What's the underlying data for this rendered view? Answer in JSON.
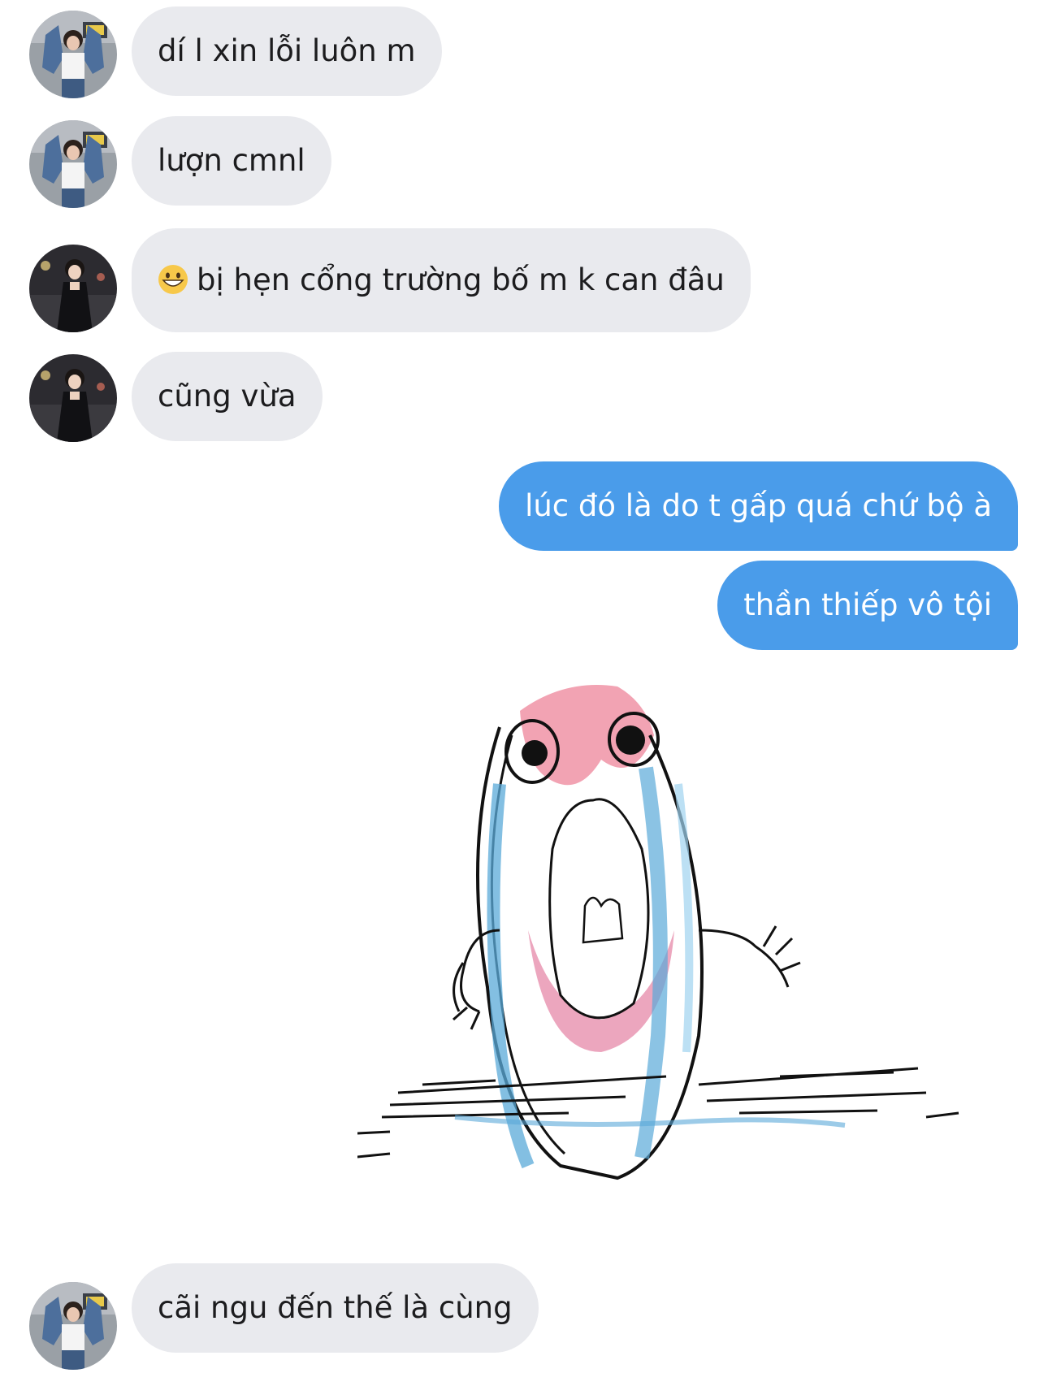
{
  "messages": [
    {
      "side": "in",
      "avatar": "user-denim-jacket",
      "text": "dí l xin lỗi luôn m"
    },
    {
      "side": "in",
      "avatar": "user-denim-jacket",
      "text": "lượn cmnl"
    },
    {
      "side": "in",
      "avatar": "user-black-dress",
      "emoji": "grinning-face-emoji",
      "text": "bị hẹn cổng trường bố m k can đâu"
    },
    {
      "side": "in",
      "avatar": "user-black-dress",
      "text": "cũng vừa"
    },
    {
      "side": "out",
      "text": "lúc đó là do t gấp quá chứ bộ à"
    },
    {
      "side": "out",
      "text": "thần thiếp vô tội"
    },
    {
      "side": "out",
      "sticker": "crying-blob-sticker"
    },
    {
      "side": "in",
      "avatar": "user-denim-jacket",
      "text": "cãi ngu đến thế là cùng"
    }
  ],
  "colors": {
    "incoming_bubble": "#e9eaee",
    "outgoing_bubble": "#4a9cea",
    "incoming_text": "#1c1c1e",
    "outgoing_text": "#ffffff"
  }
}
